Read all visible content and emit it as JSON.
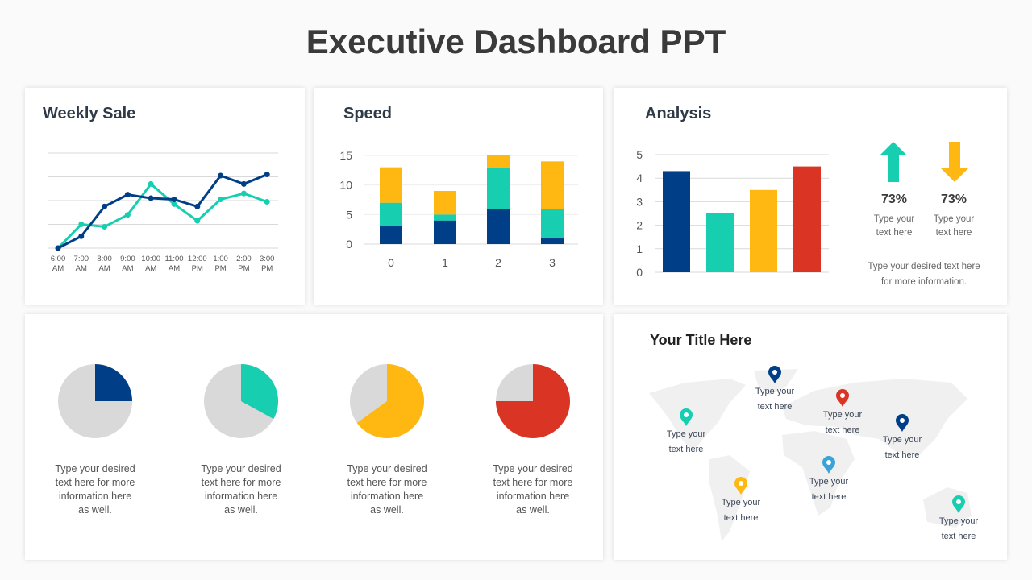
{
  "title": "Executive Dashboard PPT",
  "colors": {
    "navy": "#003f87",
    "teal": "#17cfb0",
    "yellow": "#ffb812",
    "red": "#d93424",
    "grey": "#d9d9d9"
  },
  "weekly": {
    "title": "Weekly Sale"
  },
  "speed": {
    "title": "Speed"
  },
  "analysis": {
    "title": "Analysis",
    "indicators": [
      {
        "icon": "arrow-up-icon",
        "value": "73%",
        "text1": "Type your",
        "text2": "text here"
      },
      {
        "icon": "arrow-down-icon",
        "value": "73%",
        "text1": "Type your",
        "text2": "text here"
      }
    ],
    "note1": "Type your desired text here",
    "note2": "for more information."
  },
  "pies": {
    "captions": [
      [
        "Type your desired",
        "text here for more",
        "information here",
        "as well."
      ],
      [
        "Type your desired",
        "text here for more",
        "information here",
        "as well."
      ],
      [
        "Type your desired",
        "text here for more",
        "information here",
        "as well."
      ],
      [
        "Type your desired",
        "text here for more",
        "information here",
        "as well."
      ]
    ]
  },
  "map": {
    "title": "Your Title Here",
    "pins": [
      {
        "color": "#17cfb0",
        "l1": "Type your",
        "l2": "text here"
      },
      {
        "color": "#003f87",
        "l1": "Type your",
        "l2": "text here"
      },
      {
        "color": "#d93424",
        "l1": "Type your",
        "l2": "text here"
      },
      {
        "color": "#003f87",
        "l1": "Type your",
        "l2": "text here"
      },
      {
        "color": "#3aa3d9",
        "l1": "Type your",
        "l2": "text here"
      },
      {
        "color": "#ffb812",
        "l1": "Type your",
        "l2": "text here"
      },
      {
        "color": "#17cfb0",
        "l1": "Type your",
        "l2": "text here"
      }
    ]
  },
  "chart_data": [
    {
      "type": "line",
      "title": "Weekly Sale",
      "categories": [
        "6:00 AM",
        "7:00 AM",
        "8:00 AM",
        "9:00 AM",
        "10:00 AM",
        "11:00 AM",
        "12:00 PM",
        "1:00 PM",
        "2:00 PM",
        "3:00 PM"
      ],
      "ylim": [
        0,
        4
      ],
      "grid": true,
      "series": [
        {
          "color": "#003f87",
          "values": [
            0,
            0.5,
            1.75,
            2.25,
            2.1,
            2.05,
            1.75,
            3.05,
            2.7,
            3.1
          ]
        },
        {
          "color": "#17cfb0",
          "values": [
            0,
            1,
            0.9,
            1.4,
            2.7,
            1.85,
            1.15,
            2.05,
            2.3,
            1.95
          ]
        }
      ]
    },
    {
      "type": "bar",
      "stacked": true,
      "title": "Speed",
      "categories": [
        "0",
        "1",
        "2",
        "3"
      ],
      "yticks": [
        "0",
        "5",
        "10",
        "15"
      ],
      "ylim": [
        0,
        15
      ],
      "grid": true,
      "series": [
        {
          "color": "#003f87",
          "values": [
            3,
            4,
            6,
            1
          ]
        },
        {
          "color": "#17cfb0",
          "values": [
            4,
            1,
            7,
            5
          ]
        },
        {
          "color": "#ffb812",
          "values": [
            6,
            4,
            2,
            8
          ]
        }
      ]
    },
    {
      "type": "bar",
      "title": "Analysis",
      "yticks": [
        "0",
        "1",
        "2",
        "3",
        "4",
        "5"
      ],
      "ylim": [
        0,
        5
      ],
      "grid": true,
      "values": [
        4.3,
        2.5,
        3.5,
        4.5
      ],
      "colors": [
        "#003f87",
        "#17cfb0",
        "#ffb812",
        "#d93424"
      ]
    },
    {
      "type": "pie",
      "charts": [
        {
          "value": 25,
          "color": "#003f87"
        },
        {
          "value": 33,
          "color": "#17cfb0"
        },
        {
          "value": 65,
          "color": "#ffb812"
        },
        {
          "value": 75,
          "color": "#d93424"
        }
      ]
    }
  ]
}
